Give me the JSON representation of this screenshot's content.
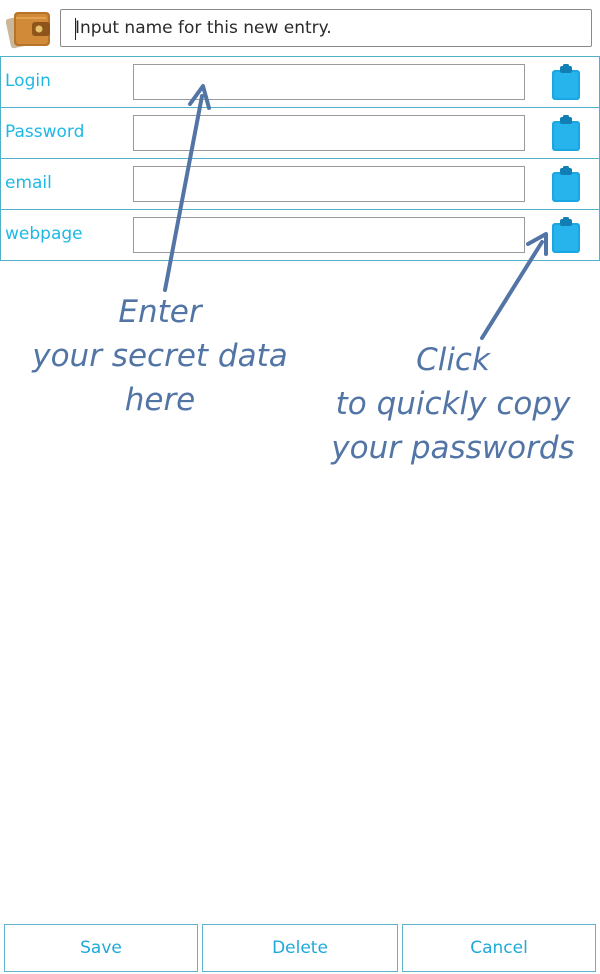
{
  "entry": {
    "name_placeholder": "Input name for this new entry."
  },
  "fields": [
    {
      "label": "Login"
    },
    {
      "label": "Password"
    },
    {
      "label": "email"
    },
    {
      "label": "webpage"
    }
  ],
  "hints": {
    "enter": [
      "Enter",
      "your secret data",
      "here"
    ],
    "click": [
      "Click",
      "to quickly copy",
      "your passwords"
    ]
  },
  "buttons": {
    "save": "Save",
    "delete": "Delete",
    "cancel": "Cancel"
  },
  "colors": {
    "label": "#1fb8e6",
    "border": "#4fb0c8",
    "clipboard": "#1aa6e2",
    "annotation": "#5275a6"
  },
  "icons": {
    "app": "wallet-icon",
    "copy": "clipboard-icon"
  }
}
